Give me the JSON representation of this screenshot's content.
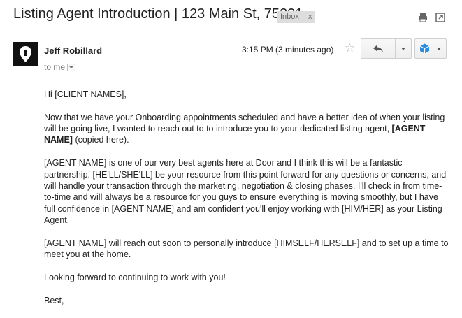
{
  "header": {
    "subject": "Listing Agent Introduction | 123 Main St, 75201",
    "label": "Inbox",
    "label_close": "x",
    "print_icon": "print-icon",
    "popout_icon": "popout-icon"
  },
  "message": {
    "sender": "Jeff Robillard",
    "to": "to me",
    "time": "3:15 PM (3 minutes ago)",
    "star": "☆",
    "body": {
      "greeting": "Hi [CLIENT NAMES],",
      "p1": "Now that we have your Onboarding appointments scheduled and have a better idea of when your listing will be going live, I wanted to reach out to to introduce you to your dedicated listing agent, ",
      "p1_bold": "[AGENT NAME]",
      "p1_end": " (copied here).",
      "p2": "[AGENT NAME] is one of our very best agents here at Door and I think this will be a fantastic partnership. [HE'LL/SHE'LL] be your resource from this point forward for any questions or concerns, and will handle your transaction through the marketing, negotiation & closing phases. I'll check in from time-to-time and will always be a resource for you guys to ensure everything is moving smoothly, but I have full confidence in [AGENT NAME] and am confident you'll enjoy working with [HIM/HER] as your Listing Agent.",
      "p3": "[AGENT NAME] will reach out soon to personally introduce [HIMSELF/HERSELF] and to set up a time to meet you at the home.",
      "p4": "Looking forward to continuing to work with you!",
      "sign": "Best,"
    }
  },
  "colors": {
    "accent": "#1a73e8",
    "extension": "#2a8ee0",
    "label_bg": "#dddddd"
  }
}
